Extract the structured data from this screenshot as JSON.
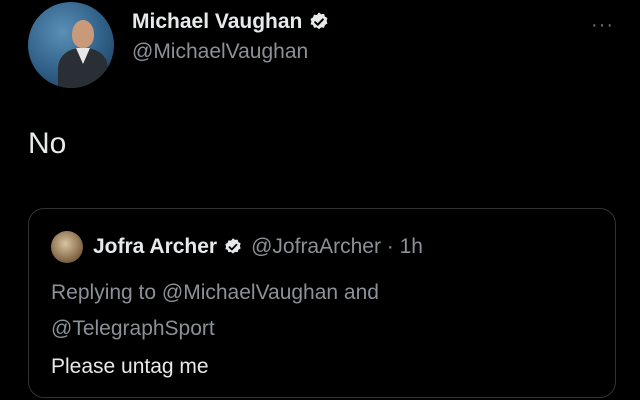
{
  "tweet": {
    "author": {
      "name": "Michael Vaughan",
      "handle": "@MichaelVaughan"
    },
    "more_label": "···",
    "text": "No",
    "quote": {
      "author": {
        "name": "Jofra Archer",
        "handle_time": "@JofraArcher · 1h"
      },
      "replying_line1": "Replying to @MichaelVaughan and",
      "replying_line2": "@TelegraphSport",
      "text": "Please untag me"
    }
  },
  "colors": {
    "background": "#000000",
    "primary_text": "#e7e9ea",
    "secondary_text": "#8b9197",
    "border": "#2f3336"
  },
  "icons": {
    "verified": "verified-badge-icon",
    "more": "more-options-icon"
  }
}
